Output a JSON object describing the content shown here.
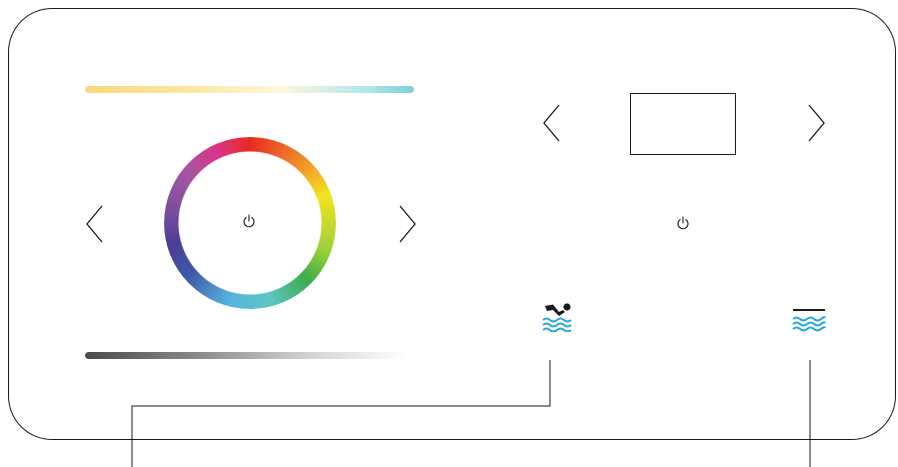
{
  "panel": {
    "name": "pool-control-panel",
    "border_color": "#1a1a1a",
    "background": "#ffffff"
  },
  "lighting": {
    "color_temperature_slider": {
      "gradient_colors": [
        "#f7d97a",
        "#fae9a6",
        "#fdf7df",
        "#b4e6ea",
        "#7ccfd9"
      ]
    },
    "color_wheel": {
      "colors": [
        "#e82a25",
        "#f08e28",
        "#f2e421",
        "#9dd03a",
        "#3cab4a",
        "#5ec6c3",
        "#57b3de",
        "#3f57a8",
        "#4b3e95",
        "#7d4e9f",
        "#a955a0",
        "#d9348a"
      ],
      "center_icon": "power-icon"
    },
    "brightness_slider": {
      "gradient_colors": [
        "#4a4a4a",
        "#8a8a8a",
        "#d4d4d4",
        "#ffffff"
      ]
    },
    "prev_icon": "chevron-left-icon",
    "next_icon": "chevron-right-icon"
  },
  "pump": {
    "display": {
      "value": ""
    },
    "prev_icon": "chevron-left-icon",
    "next_icon": "chevron-right-icon",
    "power_icon": "power-icon"
  },
  "modes": {
    "swim_icon": "swimmer-icon",
    "water_level_icon": "water-level-icon",
    "accent_color": "#22a6dd"
  }
}
